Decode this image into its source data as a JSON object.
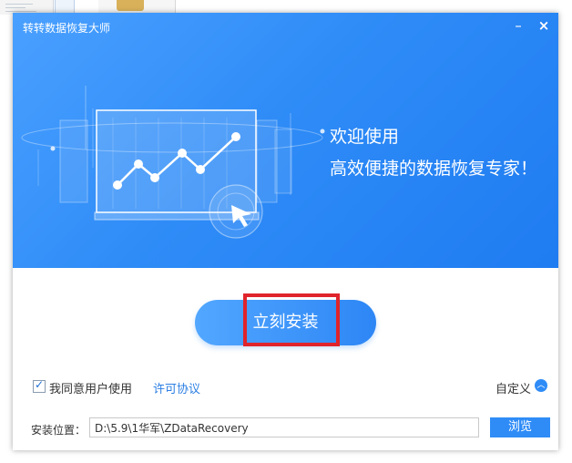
{
  "window": {
    "title": "转转数据恢复大师",
    "minimize_glyph": "–",
    "close_glyph": "×"
  },
  "banner": {
    "line1": "欢迎使用",
    "line2": "高效便捷的数据恢复专家！",
    "illustration_icon": "line-chart-monitor-icon"
  },
  "install": {
    "button_label": "立刻安装"
  },
  "agreement": {
    "checked": true,
    "text": "我同意用户使用",
    "link_text": "许可协议"
  },
  "custom": {
    "label": "自定义",
    "icon": "chevron-up-icon"
  },
  "path": {
    "label": "安装位置：",
    "value": "D:\\5.9\\1华军\\ZDataRecovery",
    "browse_label": "浏览"
  },
  "colors": {
    "banner_blue": "#2f8cf7",
    "accent": "#2b7fe3",
    "highlight_red": "#e0242b"
  }
}
